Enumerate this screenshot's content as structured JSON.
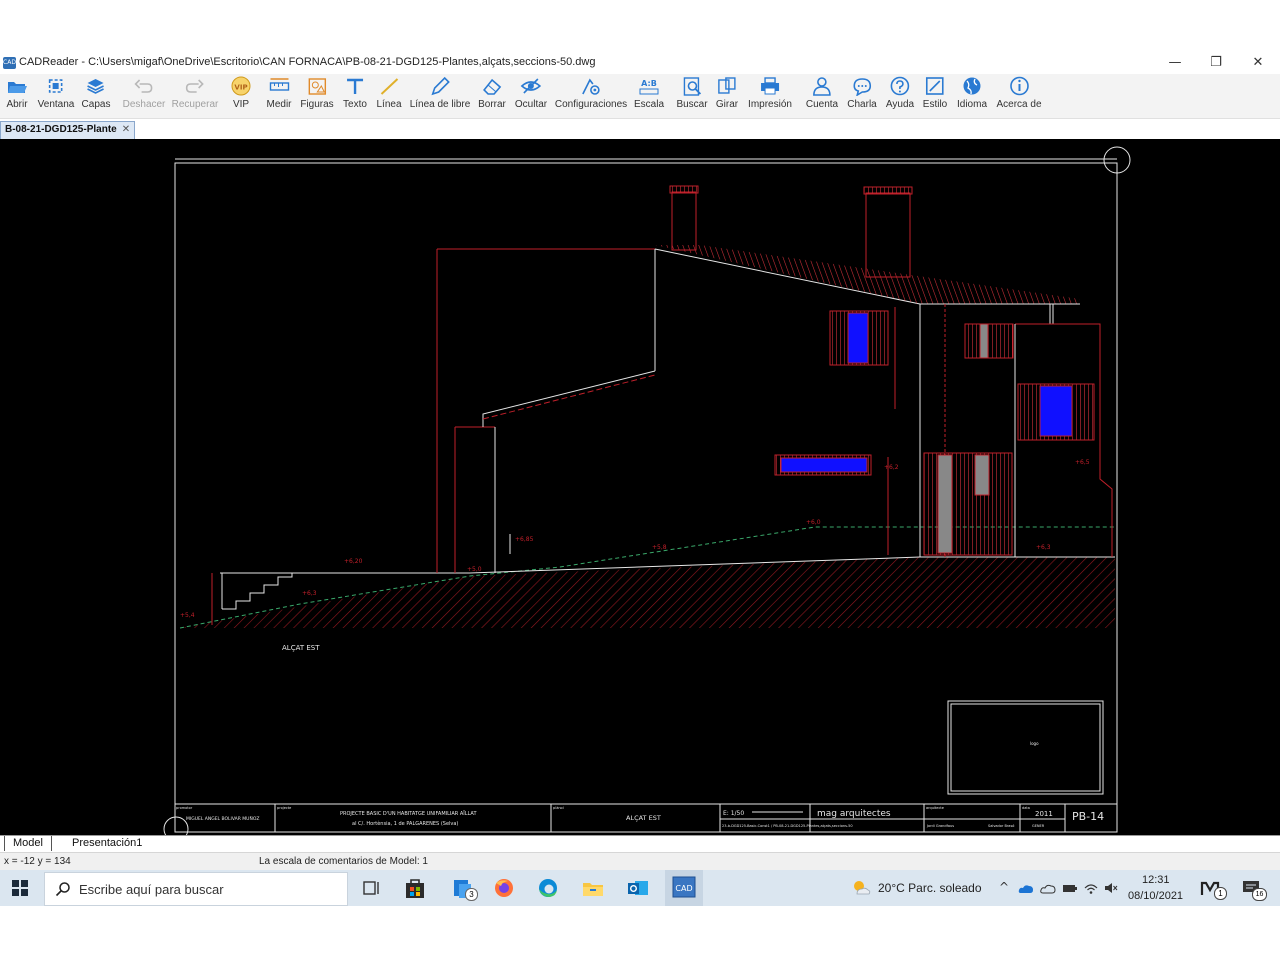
{
  "window": {
    "app_icon_text": "CAD",
    "title": "CADReader - C:\\Users\\migaf\\OneDrive\\Escritorio\\CAN FORNACA\\PB-08-21-DGD125-Plantes,alçats,seccions-50.dwg",
    "minimize": "—",
    "restore": "❐",
    "close": "✕"
  },
  "toolbar": [
    {
      "label": "Abrir",
      "icon": "folder-open-icon",
      "enabled": true
    },
    {
      "label": "Ventana",
      "icon": "window-fit-icon",
      "enabled": true
    },
    {
      "label": "Capas",
      "icon": "layers-icon",
      "enabled": true
    },
    {
      "label": "Deshacer",
      "icon": "undo-icon",
      "enabled": false
    },
    {
      "label": "Recuperar",
      "icon": "redo-icon",
      "enabled": false
    },
    {
      "label": "VIP",
      "icon": "vip-badge-icon",
      "enabled": true
    },
    {
      "label": "Medir",
      "icon": "measure-icon",
      "enabled": true
    },
    {
      "label": "Figuras",
      "icon": "shapes-icon",
      "enabled": true
    },
    {
      "label": "Texto",
      "icon": "text-icon",
      "enabled": true
    },
    {
      "label": "Línea",
      "icon": "line-icon",
      "enabled": true
    },
    {
      "label": "Línea de libre",
      "icon": "pencil-icon",
      "enabled": true
    },
    {
      "label": "Borrar",
      "icon": "eraser-icon",
      "enabled": true
    },
    {
      "label": "Ocultar",
      "icon": "hide-eye-icon",
      "enabled": true
    },
    {
      "label": "Configuraciones",
      "icon": "settings-icon",
      "enabled": true
    },
    {
      "label": "Escala",
      "icon": "scale-icon",
      "enabled": true
    },
    {
      "label": "Buscar",
      "icon": "search-doc-icon",
      "enabled": true
    },
    {
      "label": "Girar",
      "icon": "rotate-icon",
      "enabled": true
    },
    {
      "label": "Impresión",
      "icon": "printer-icon",
      "enabled": true
    },
    {
      "label": "Cuenta",
      "icon": "user-icon",
      "enabled": true
    },
    {
      "label": "Charla",
      "icon": "chat-icon",
      "enabled": true
    },
    {
      "label": "Ayuda",
      "icon": "help-icon",
      "enabled": true
    },
    {
      "label": "Estilo",
      "icon": "style-icon",
      "enabled": true
    },
    {
      "label": "Idioma",
      "icon": "globe-icon",
      "enabled": true
    },
    {
      "label": "Acerca de",
      "icon": "info-icon",
      "enabled": true
    }
  ],
  "vip_badge_text": "VIP",
  "scale_icon_text": "A:B",
  "document_tab": {
    "label": "B-08-21-DGD125-Plante",
    "close": "✕"
  },
  "drawing": {
    "view_label": "ALÇAT EST",
    "stamp_text": "logo",
    "levels": [
      "+6,20",
      "+6,3",
      "+6,85",
      "+5,0",
      "+5,4",
      "+5,8",
      "+6,0",
      "+6,3",
      "+6,5",
      "+6,2"
    ],
    "title_block": {
      "promotor_label": "promotor",
      "promotor": "MIGUEL ANGEL BOLIVAR MUÑOZ",
      "project_label": "projecte",
      "project_line1": "PROJECTE BASIC D'UN HABITATGE UNIFAMILIAR AÏLLAT",
      "project_line2": "al C/. Hortènsia, 1   de PALGARENES (Selva)",
      "plan_label": "plànol",
      "plan": "ALÇAT EST",
      "scale": "E: 1/50",
      "studio": "mag  arquitectes",
      "date_label": "data",
      "year": "2011",
      "sheet": "PB-14",
      "file_path": "23-b-DGD125-Basic-Const1 / PB-08-21-DGD125-Plantes,alçats,seccions-50",
      "author_label": "arquitecte",
      "author": "Jordi Grandfaus",
      "collaborator": "Salvador Brasó",
      "month": "GENER"
    }
  },
  "layout_tabs": [
    "Model",
    "Presentación1"
  ],
  "status": {
    "coords": "x = -12 y = 134",
    "scale_note": "La escala de comentarios de Model: 1"
  },
  "taskbar": {
    "search_placeholder": "Escribe aquí para buscar",
    "store_badge": "3",
    "weather": "20°C  Parc. soleado",
    "time": "12:31",
    "date": "08/10/2021",
    "notification_count": "16",
    "lang_badge": "1"
  }
}
